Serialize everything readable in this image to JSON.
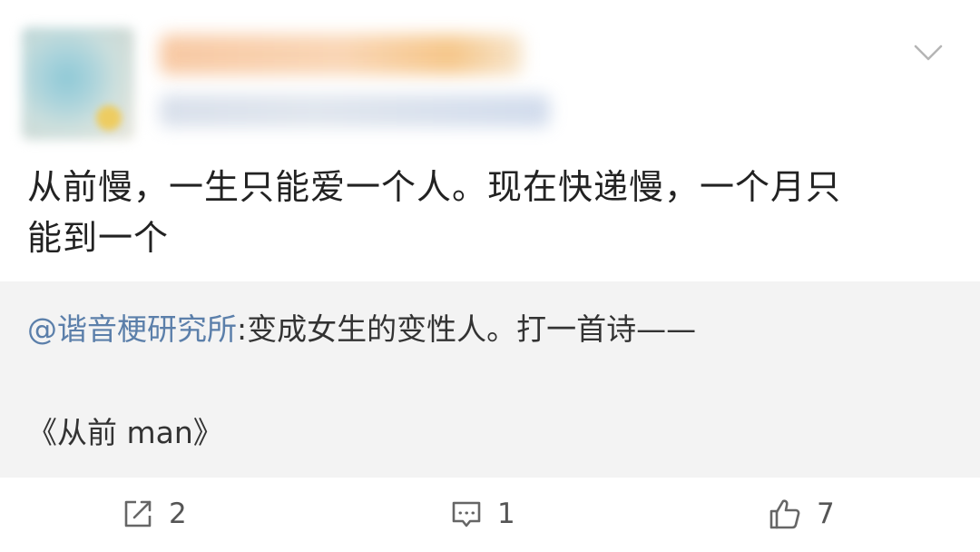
{
  "post": {
    "text_line1": "从前慢，一生只能爱一个人。现在快递慢，一个月只",
    "text_line2": "能到一个"
  },
  "quote": {
    "mention": "@谐音梗研究所",
    "text": ":变成女生的变性人。打一首诗——",
    "answer": "《从前 man》"
  },
  "actions": {
    "share_count": "2",
    "comment_count": "1",
    "like_count": "7"
  },
  "icons": {
    "menu": "chevron-down-icon",
    "share": "share-icon",
    "comment": "comment-icon",
    "like": "thumbs-up-icon"
  },
  "colors": {
    "mention": "#5b7faa",
    "quote_background": "#f3f3f3"
  }
}
